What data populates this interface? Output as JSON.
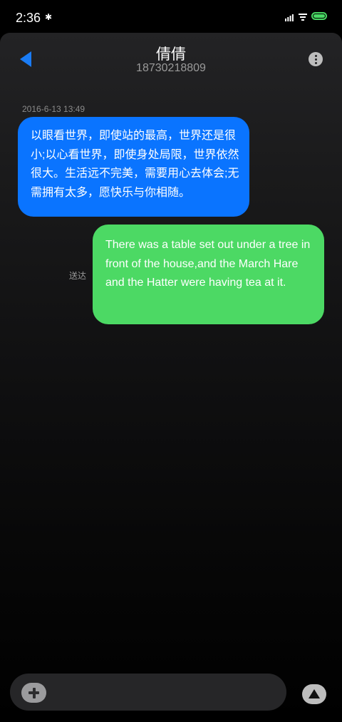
{
  "status_bar": {
    "time": "2:36",
    "icons": [
      "bluetooth-icon",
      "signal-icon",
      "wifi-icon",
      "battery-icon"
    ]
  },
  "header": {
    "back_icon": "back-arrow-icon",
    "contact_name": "倩倩",
    "contact_number": "18730218809",
    "more_icon": "more-info-icon"
  },
  "conversation": {
    "timestamp": "2016-6-13 13:49",
    "messages": [
      {
        "direction": "incoming",
        "text": "以眼看世界，即使站的最高，世界还是很小;以心看世界，即使身处局限，世界依然很大。生活远不完美，需要用心去体会;无需拥有太多，愿快乐与你相随。"
      },
      {
        "direction": "outgoing",
        "text": "There was a table set out under a tree in front of the house,and the March Hare and the Hatter were having tea at it.",
        "status": "送达"
      }
    ]
  },
  "composer": {
    "add_icon": "add-attachment-icon",
    "send_icon": "send-icon"
  },
  "colors": {
    "incoming_bubble": "#0a74ff",
    "outgoing_bubble": "#4cd964",
    "accent": "#1a7cf5"
  }
}
